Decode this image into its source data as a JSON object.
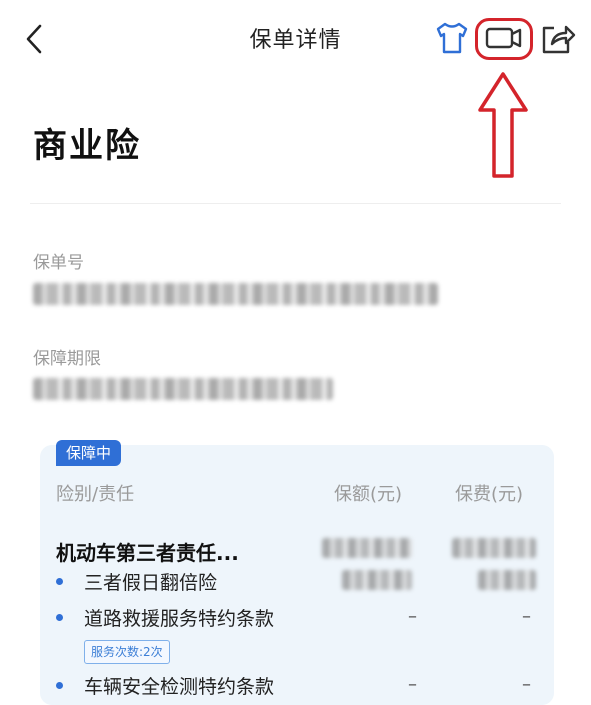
{
  "header": {
    "title": "保单详情",
    "icons": [
      "back-chevron-icon",
      "tshirt-icon",
      "video-camera-icon",
      "share-icon"
    ],
    "colors": {
      "accent": "#2f6fd6",
      "annotation": "#d4242b"
    }
  },
  "policy": {
    "type_title": "商业险",
    "number_label": "保单号",
    "period_label": "保障期限"
  },
  "coverage": {
    "status_tag": "保障中",
    "columns": {
      "item": "险别/责任",
      "amount": "保额(元)",
      "premium": "保费(元)"
    },
    "main_item": "机动车第三者责任...",
    "sub_items": [
      {
        "name": "三者假日翻倍险",
        "amount": "",
        "premium": ""
      },
      {
        "name": "道路救援服务特约条款",
        "amount": "–",
        "premium": "–",
        "badge": "服务次数:2次"
      },
      {
        "name": "车辆安全检测特约条款",
        "amount": "–",
        "premium": "–"
      }
    ]
  }
}
